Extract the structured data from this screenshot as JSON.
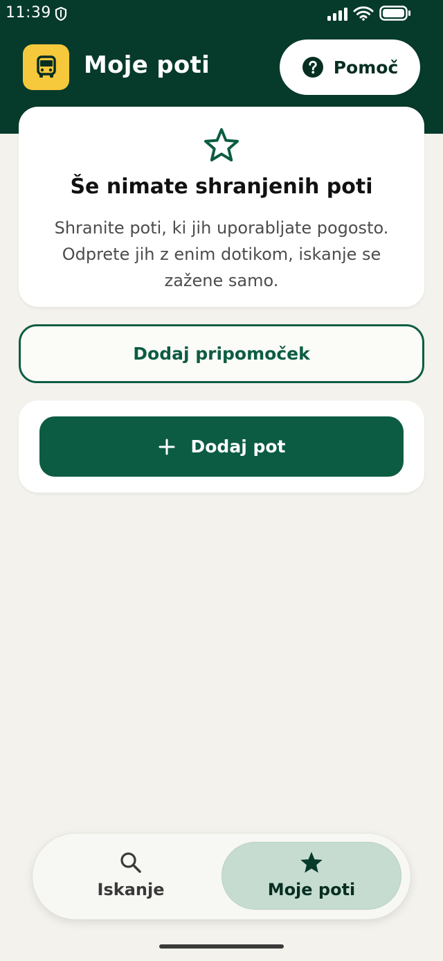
{
  "status_bar": {
    "time": "11:39",
    "icons": [
      "shield-icon",
      "signal-icon",
      "wifi-icon",
      "battery-icon"
    ]
  },
  "header": {
    "logo_icon": "bus-icon",
    "title": "Moje poti",
    "help_button": {
      "icon": "question-circle-icon",
      "label": "Pomoč"
    }
  },
  "empty_state": {
    "icon": "star-outline-icon",
    "title": "Še nimate shranjenih poti",
    "description": "Shranite poti, ki jih uporabljate pogosto. Odprete jih z enim dotikom, iskanje se zažene samo."
  },
  "widget_button": {
    "label": "Dodaj pripomoček"
  },
  "add_route_button": {
    "icon": "plus-icon",
    "label": "Dodaj pot"
  },
  "bottom_nav": {
    "tabs": [
      {
        "id": "search",
        "icon": "search-icon",
        "label": "Iskanje",
        "active": false
      },
      {
        "id": "saved",
        "icon": "star-filled-icon",
        "label": "Moje poti",
        "active": true
      }
    ]
  },
  "colors": {
    "header_bg": "#063a2b",
    "brand_green": "#0c5c43",
    "logo_yellow": "#f6c83b",
    "page_bg": "#f3f2ec",
    "active_tab_bg": "#c7dcd1"
  }
}
